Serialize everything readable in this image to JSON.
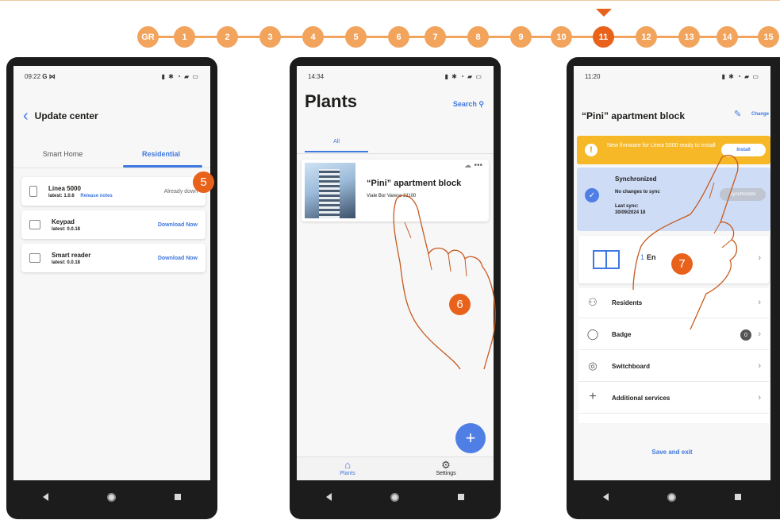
{
  "stepbar": {
    "steps": [
      "GR",
      "1",
      "2",
      "3",
      "4",
      "5",
      "6",
      "7",
      "8",
      "9",
      "10",
      "11",
      "12",
      "13",
      "14",
      "15"
    ],
    "active_step": "11"
  },
  "callouts": [
    "5",
    "6",
    "7"
  ],
  "phone1": {
    "status_time": "09:22",
    "status_left_icons": "G ⋈",
    "header_title": "Update center",
    "tabs": [
      "Smart Home",
      "Residential"
    ],
    "active_tab": "Residential",
    "devices": [
      {
        "name": "Linea 5000",
        "version": "latest: 1.0.6",
        "release_notes": "Release notes",
        "action": "Already down"
      },
      {
        "name": "Keypad",
        "version": "latest: 0.0.18",
        "action": "Download Now"
      },
      {
        "name": "Smart reader",
        "version": "latest: 0.0.18",
        "action": "Download Now"
      }
    ]
  },
  "phone2": {
    "status_time": "14:34",
    "title": "Plants",
    "search_label": "Search",
    "filter_tab": "All",
    "plant": {
      "name": "“Pini” apartment block",
      "address": "Viale Bor Varese 21100"
    },
    "bottom_nav": [
      "Plants",
      "Settings"
    ],
    "fab_icon": "plus-icon"
  },
  "phone3": {
    "status_time": "11:20",
    "title": "“Pini” apartment block",
    "change_label": "Change",
    "banner_text": "New firmware for Linea 5000 ready to install",
    "install_label": "Install",
    "sync_title": "Synchronized",
    "sync_subtitle": "No changes to sync",
    "last_sync_label": "Last sync:",
    "last_sync_value": "30/09/2024 18",
    "sync_button": "Synchronize",
    "rooms_count": "1",
    "rooms_label": "En",
    "menu": [
      {
        "label": "Residents",
        "icon": "residents-icon"
      },
      {
        "label": "Badge",
        "icon": "badge-icon",
        "count": "0"
      },
      {
        "label": "Switchboard",
        "icon": "switchboard-icon"
      },
      {
        "label": "Additional services",
        "icon": "plus-icon"
      }
    ],
    "save_label": "Save and exit"
  },
  "colors": {
    "accent": "#3f78e0",
    "step": "#f2a35c",
    "step_active": "#e8621b",
    "banner": "#f6b826"
  }
}
